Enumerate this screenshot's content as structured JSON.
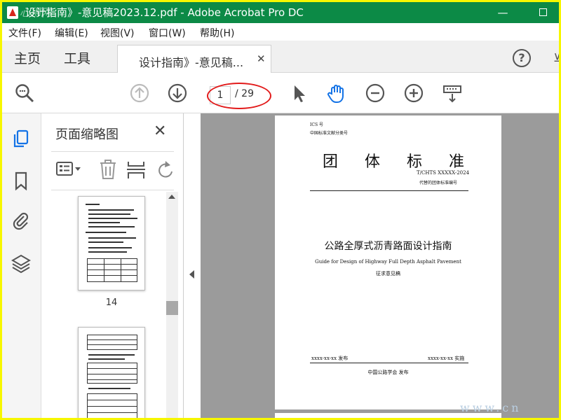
{
  "window": {
    "title": "设计指南》-意见稿2023.12.pdf - Adobe Acrobat Pro DC",
    "minimize": "—"
  },
  "menu": [
    "文件(F)",
    "编辑(E)",
    "视图(V)",
    "窗口(W)",
    "帮助(H)"
  ],
  "tabs": {
    "home": "主页",
    "tools": "工具",
    "document": "设计指南》-意见稿...",
    "close": "✕",
    "help": "?"
  },
  "toolbar": {
    "current_page": "1",
    "total_pages": "/ 29",
    "icons": [
      "search-zoom-icon",
      "page-up-icon",
      "page-down-icon",
      "select-arrow-icon",
      "hand-tool-icon",
      "zoom-out-icon",
      "zoom-in-icon",
      "keyboard-scroll-icon"
    ]
  },
  "sidebar": {
    "panel_title": "页面缩略图",
    "close": "✕",
    "thumbnails": [
      {
        "page_number": "14"
      }
    ]
  },
  "document_page": {
    "ics": "ICS 号",
    "classification": "中国标准文献分类号",
    "heading": "团体标准",
    "code": "T/CHTS XXXXX-2024",
    "replaces": "代替的团体标准编号",
    "title_cn": "公路全厚式沥青路面设计指南",
    "title_en": "Guide for Design of Highway Full Depth Asphalt Pavement",
    "stage": "征求意见稿",
    "issued": "xxxx-xx-xx 发布",
    "implemented": "xxxx-xx-xx 实施",
    "organization": "中国公路学会  发布"
  },
  "colors": {
    "titlebar": "#0c8a46",
    "accent_blue": "#1473e6",
    "highlight_circle": "#e21a1a",
    "border_yellow": "#f7f700"
  }
}
